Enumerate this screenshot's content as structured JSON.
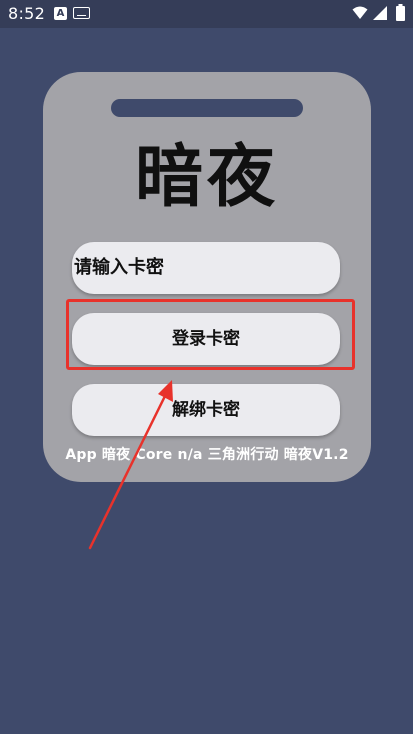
{
  "status_bar": {
    "time": "8:52",
    "badge_letter": "A"
  },
  "card": {
    "title": "暗夜",
    "input_placeholder": "请输入卡密",
    "login_label": "登录卡密",
    "unbind_label": "解绑卡密",
    "footer_text": "App 暗夜 Core n/a 三角洲行动 暗夜V1.2"
  },
  "colors": {
    "background": "#3f4a6b",
    "card": "#a3a3a8",
    "button": "#ebebef",
    "annotation": "#e8322b"
  }
}
